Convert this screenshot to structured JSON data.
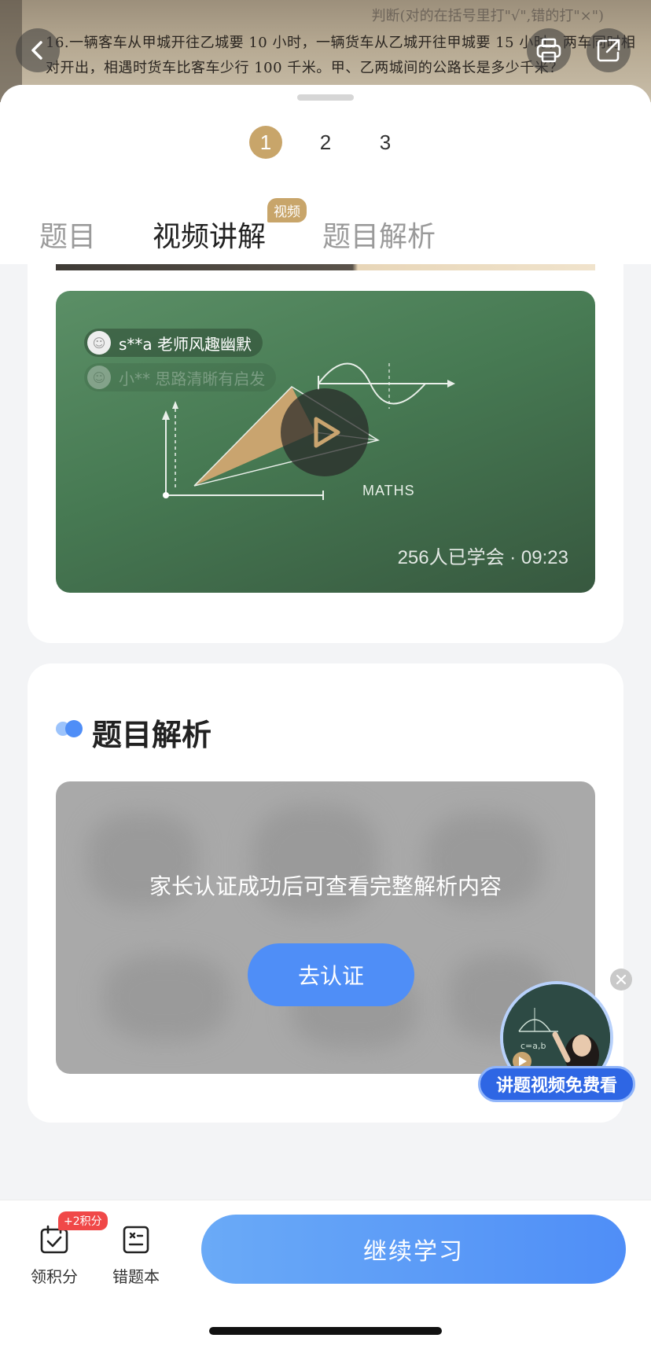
{
  "photo": {
    "line1": "16.一辆客车从甲城开往乙城要 10 小时，一辆货车从乙城开往甲城要 15 小时，两车同时相",
    "line2": "对开出，相遇时货车比客车少行 100 千米。甲、乙两城间的公路长是多少千米？",
    "faded_text": "判断(对的在括号里打\"√\",错的打\"×\")"
  },
  "pager": [
    "1",
    "2",
    "3"
  ],
  "tabs": {
    "question": "题目",
    "video": "视频讲解",
    "video_badge": "视频",
    "analysis": "题目解析"
  },
  "video": {
    "danmu1": "s**a 老师风趣幽默",
    "danmu2": "小** 思路清晰有启发",
    "chalk_text": "MATHS",
    "meta": "256人已学会 · 09:23"
  },
  "analysis": {
    "title": "题目解析",
    "lock_message": "家长认证成功后可查看完整解析内容",
    "cert_button": "去认证"
  },
  "promo": {
    "label": "讲题视频免费看",
    "board_text": "c=a,b"
  },
  "bottom": {
    "points_label": "领积分",
    "points_badge": "+2积分",
    "mistakes_label": "错题本",
    "continue": "继续学习"
  },
  "colors": {
    "accent": "#4f8ef7",
    "gold": "#c8a56a",
    "board_green": "#477a53"
  }
}
